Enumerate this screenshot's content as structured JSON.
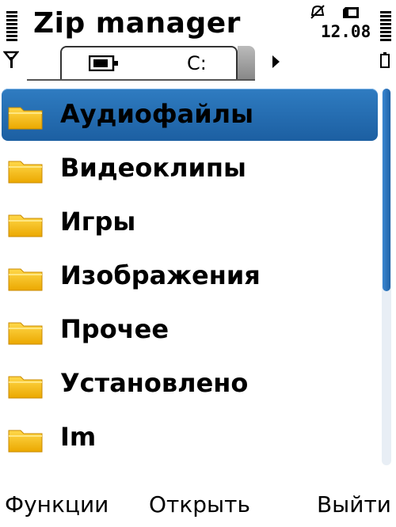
{
  "status": {
    "title": "Zip manager",
    "time": "12.08"
  },
  "tabs": {
    "active_label": "C:",
    "active_icon": "phone-memory-icon"
  },
  "list": {
    "items": [
      {
        "label": "Аудиофайлы",
        "icon": "folder-icon",
        "selected": true
      },
      {
        "label": "Видеоклипы",
        "icon": "folder-icon",
        "selected": false
      },
      {
        "label": "Игры",
        "icon": "folder-icon",
        "selected": false
      },
      {
        "label": "Изображения",
        "icon": "folder-icon",
        "selected": false
      },
      {
        "label": "Прочее",
        "icon": "folder-icon",
        "selected": false
      },
      {
        "label": "Установлено",
        "icon": "folder-icon",
        "selected": false
      },
      {
        "label": "Im",
        "icon": "folder-icon",
        "selected": false
      }
    ],
    "scroll_fraction_visible": 0.54
  },
  "softkeys": {
    "left": "Функции",
    "center": "Открыть",
    "right": "Выйти"
  },
  "colors": {
    "selection": "#1c5fa2",
    "folder": "#f5c012"
  }
}
